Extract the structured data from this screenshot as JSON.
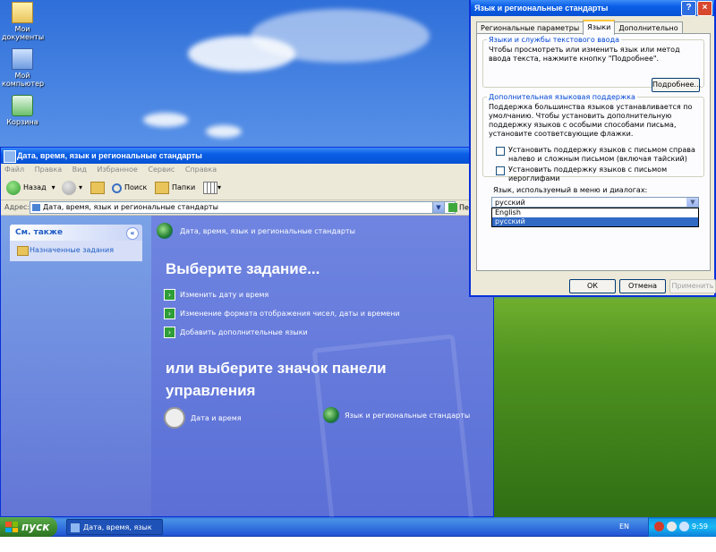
{
  "desktop": {
    "icons": [
      {
        "label": "Мои документы"
      },
      {
        "label": "Мой компьютер"
      },
      {
        "label": "Корзина"
      }
    ]
  },
  "explorer": {
    "title": "Дата, время, язык и региональные стандарты",
    "menu": [
      "Файл",
      "Правка",
      "Вид",
      "Избранное",
      "Сервис",
      "Справка"
    ],
    "toolbar": {
      "back": "Назад",
      "search": "Поиск",
      "folders": "Папки"
    },
    "address": {
      "label": "Адрес:",
      "value": "Дата, время, язык и региональные стандарты",
      "go": "Пер"
    },
    "see_also": {
      "header": "См. также",
      "item": "Назначенные задания"
    },
    "main": {
      "heading": "Дата, время, язык и региональные стандарты",
      "pick_task": "Выберите задание...",
      "tasks": [
        "Изменить дату и время",
        "Изменение формата отображения чисел, даты и времени",
        "Добавить дополнительные языки"
      ],
      "or_pick": "или выберите значок панели управления",
      "icons": [
        "Дата и время",
        "Язык и региональные стандарты"
      ]
    }
  },
  "dialog": {
    "title": "Язык и региональные стандарты",
    "tabs": [
      "Региональные параметры",
      "Языки",
      "Дополнительно"
    ],
    "group1": {
      "legend": "Языки и службы текстового ввода",
      "text": "Чтобы просмотреть или изменить язык или метод ввода текста, нажмите кнопку \"Подробнее\".",
      "button": "Подробнее..."
    },
    "group2": {
      "legend": "Дополнительная языковая поддержка",
      "text": "Поддержка большинства языков устанавливается по умолчанию. Чтобы установить дополнительную поддержку языков с особыми способами письма, установите соответсвующие флажки.",
      "check1": "Установить поддержку языков с письмом справа налево и сложным письмом (включая тайский)",
      "check2": "Установить поддержку языков с письмом иероглифами"
    },
    "ui_lang": {
      "label": "Язык, используемый в меню и диалогах:",
      "selected": "русский",
      "options": [
        "English",
        "русский"
      ]
    },
    "buttons": {
      "ok": "ОК",
      "cancel": "Отмена",
      "apply": "Применить"
    }
  },
  "taskbar": {
    "start": "пуск",
    "window": "Дата, время, язык и...",
    "lang": "EN",
    "clock": "9:59"
  }
}
